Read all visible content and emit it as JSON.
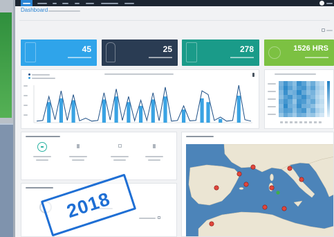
{
  "header": {
    "page_title": "Dashboard"
  },
  "nav": {
    "bar_color": "#1c2531",
    "active_color": "#2b86d6"
  },
  "cards": [
    {
      "value": "45",
      "color": "#2fa4ea",
      "icon": "monitor-icon"
    },
    {
      "value": "25",
      "color": "#2a3c53",
      "icon": "hand-icon"
    },
    {
      "value": "278",
      "color": "#1a9b89",
      "icon": "tablet-icon"
    },
    {
      "value": "1526 HRS",
      "color": "#7cc142",
      "icon": "clock-icon"
    }
  ],
  "main": {
    "trend_chart": {
      "type": "bar-line",
      "line_color": "#1d4f86",
      "bar_color": "#3aa3e3",
      "line": [
        4,
        6,
        70,
        8,
        85,
        6,
        75,
        5,
        12,
        4,
        6,
        80,
        7,
        90,
        6,
        70,
        5,
        60,
        6,
        80,
        5,
        95,
        4,
        6,
        45,
        5,
        6,
        85,
        75,
        6,
        15,
        4,
        6,
        100,
        8,
        4
      ],
      "bars": [
        0,
        0,
        55,
        0,
        65,
        0,
        60,
        0,
        0,
        0,
        0,
        62,
        0,
        70,
        0,
        55,
        0,
        45,
        0,
        62,
        0,
        70,
        0,
        0,
        35,
        0,
        0,
        65,
        55,
        0,
        10,
        0,
        0,
        72,
        0,
        0
      ]
    },
    "heatmap": {
      "low_color": "#e6f3fb",
      "high_color": "#1c7fc4",
      "values": [
        [
          0.55,
          0.8,
          0.6,
          0.45,
          0.85,
          0.7,
          0.4,
          0.6,
          0.3,
          0.2
        ],
        [
          0.6,
          0.9,
          0.7,
          0.5,
          0.75,
          0.8,
          0.5,
          0.7,
          0.35,
          0.25
        ],
        [
          0.5,
          0.85,
          0.55,
          0.6,
          0.9,
          0.65,
          0.45,
          0.55,
          0.3,
          0.2
        ],
        [
          0.45,
          0.7,
          0.8,
          0.55,
          0.7,
          0.85,
          0.6,
          0.5,
          0.25,
          0.15
        ],
        [
          0.6,
          0.8,
          0.65,
          0.4,
          0.8,
          0.75,
          0.5,
          0.65,
          0.3,
          0.2
        ],
        [
          0.5,
          0.9,
          0.6,
          0.5,
          0.85,
          0.6,
          0.55,
          0.45,
          0.2,
          0.15
        ],
        [
          0.55,
          0.75,
          0.7,
          0.45,
          0.7,
          0.8,
          0.4,
          0.6,
          0.3,
          0.2
        ],
        [
          0.4,
          0.65,
          0.5,
          0.35,
          0.6,
          0.55,
          0.35,
          0.4,
          0.2,
          0.1
        ]
      ]
    }
  },
  "stats": {
    "ring_color": "#2bb3a3"
  },
  "map": {
    "sea_color": "#4c84b9",
    "land_color": "#ebe5d3",
    "marker_color": "#e0463c",
    "marker_alt_color": "#3fae49"
  },
  "stamp": {
    "text": "2018",
    "color": "#1f6fd4"
  }
}
